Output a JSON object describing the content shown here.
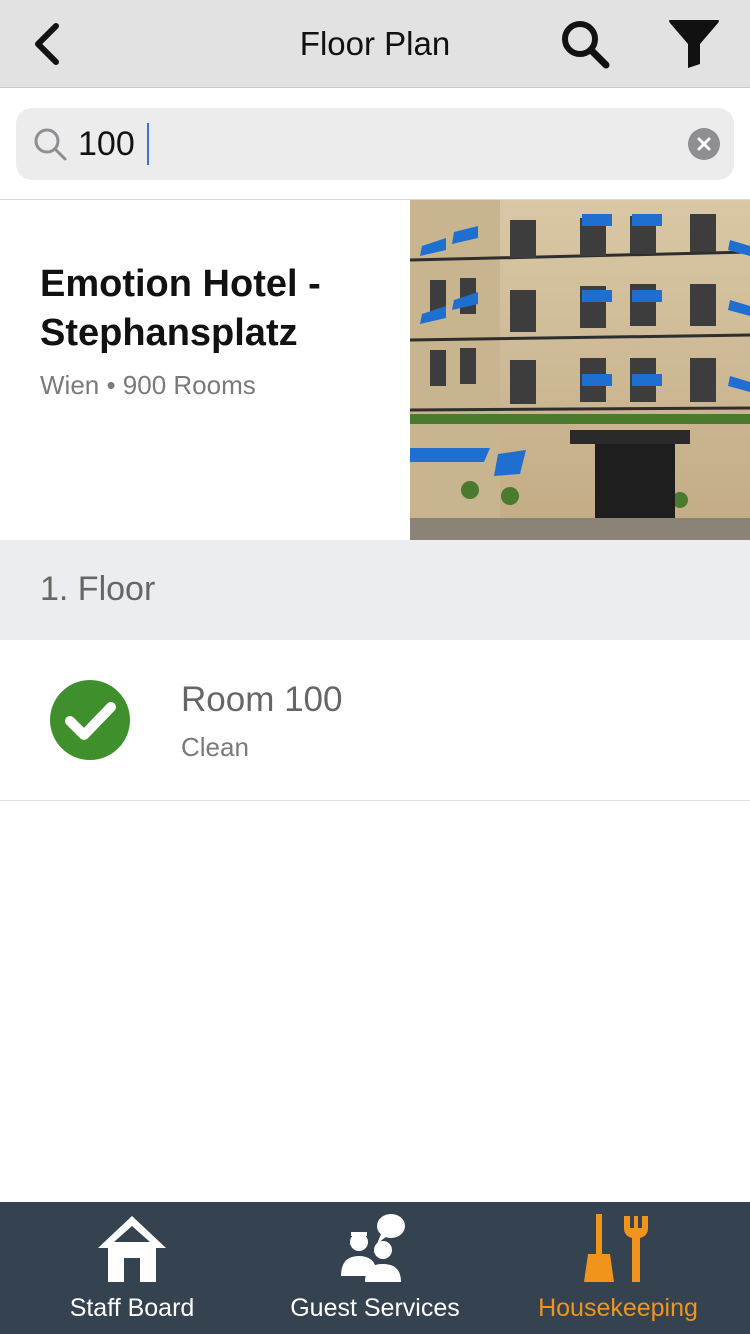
{
  "nav": {
    "title": "Floor Plan",
    "back_icon": "chevron-left-icon",
    "search_icon": "search-icon",
    "filter_icon": "filter-icon"
  },
  "search": {
    "value": "100",
    "placeholder": "",
    "clear_icon": "clear-icon"
  },
  "hotel": {
    "name": "Emotion Hotel - Stephansplatz",
    "meta": "Wien • 900 Rooms"
  },
  "floor": {
    "label": "1. Floor"
  },
  "rooms": [
    {
      "name": "Room 100",
      "status": "Clean",
      "status_color": "#3f8f2d"
    }
  ],
  "tabs": [
    {
      "label": "Staff Board",
      "icon": "home-icon",
      "active": false
    },
    {
      "label": "Guest Services",
      "icon": "guest-services-icon",
      "active": false
    },
    {
      "label": "Housekeeping",
      "icon": "housekeeping-icon",
      "active": true
    }
  ],
  "colors": {
    "nav_bg": "#e2e2e2",
    "tab_bar_bg": "#34434f",
    "active_tab": "#f0941e",
    "floor_header_bg": "#eaeef0"
  }
}
